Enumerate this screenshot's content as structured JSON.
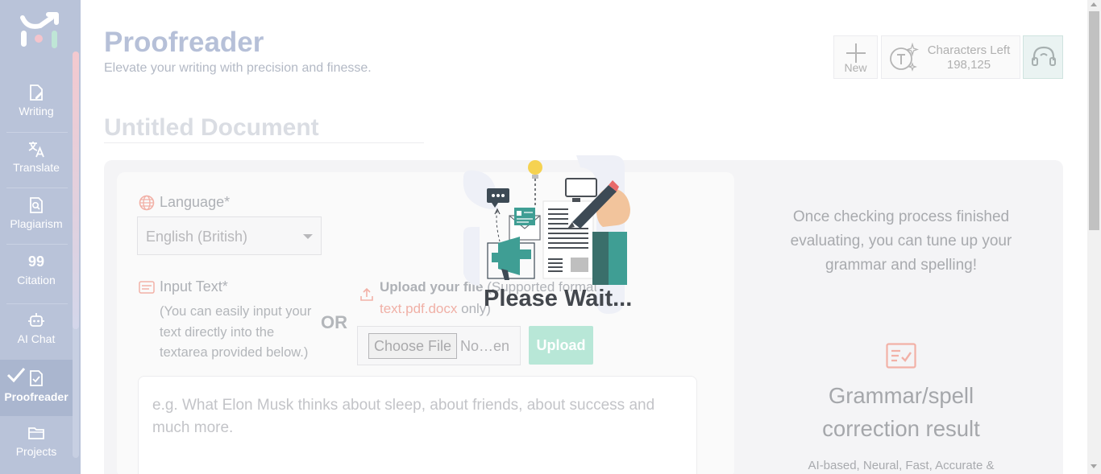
{
  "sidebar": {
    "items": [
      {
        "label": "Writing",
        "icon": "writing-icon"
      },
      {
        "label": "Translate",
        "icon": "translate-icon"
      },
      {
        "label": "Plagiarism",
        "icon": "plagiarism-icon"
      },
      {
        "label": "Citation",
        "icon": "citation-icon",
        "glyph": "99"
      },
      {
        "label": "AI Chat",
        "icon": "robot-icon"
      },
      {
        "label": "Proofreader",
        "icon": "proofreader-icon",
        "active": true
      },
      {
        "label": "Projects",
        "icon": "folder-icon"
      }
    ]
  },
  "header": {
    "title": "Proofreader",
    "subtitle": "Elevate your writing with precision and finesse.",
    "new_label": "New",
    "chars_left_label": "Characters Left",
    "chars_left_value": "198,125"
  },
  "document": {
    "title": "Untitled Document"
  },
  "form": {
    "language_label": "Language*",
    "language_value": "English (British)",
    "input_label": "Input Text*",
    "input_hint": "(You can easily input your text directly into the textarea provided below.)",
    "or_label": "OR",
    "upload_label": "Upload your file",
    "upload_formats_prefix": " (Supported formats",
    "upload_formats": "text.pdf.docx",
    "upload_formats_suffix": " only)",
    "choose_file_label": "Choose File",
    "file_name": "No…en",
    "upload_button": "Upload",
    "textarea_placeholder": "e.g. What Elon Musk thinks about sleep, about friends, about success and much more."
  },
  "result_panel": {
    "info": "Once checking process finished evaluating, you can tune up your grammar and spelling!",
    "heading": "Grammar/spell correction result",
    "sub": "AI-based, Neural, Fast, Accurate &"
  },
  "overlay": {
    "message": "Please Wait..."
  },
  "colors": {
    "sidebar_bg": "#b9c3d9",
    "accent_green": "#b8e7d7",
    "accent_red": "#f0b0a6",
    "illustration_teal": "#3f9e94"
  }
}
